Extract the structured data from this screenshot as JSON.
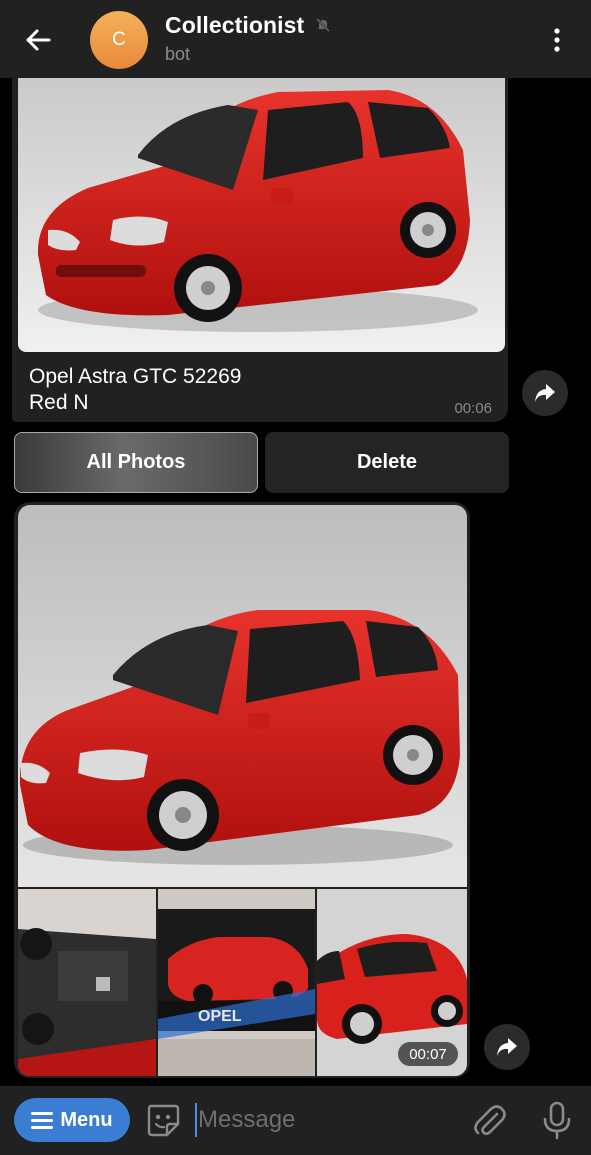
{
  "header": {
    "title": "Collectionist",
    "subtitle": "bot",
    "avatar_letter": "C",
    "back_icon": "arrow-left-icon",
    "mute_icon": "bell-muted-icon",
    "more_icon": "more-vertical-icon",
    "avatar_color": "#F0A04B"
  },
  "messages": [
    {
      "type": "photo",
      "caption_line1": "Opel Astra GTC 52269",
      "caption_line2": "Red N",
      "time": "00:06"
    },
    {
      "type": "album",
      "photo_count": 4,
      "time": "00:07"
    }
  ],
  "inline_buttons": {
    "all_photos": "All Photos",
    "delete": "Delete"
  },
  "input_bar": {
    "menu_label": "Menu",
    "placeholder": "Message",
    "menu_color": "#3A7DD3"
  }
}
